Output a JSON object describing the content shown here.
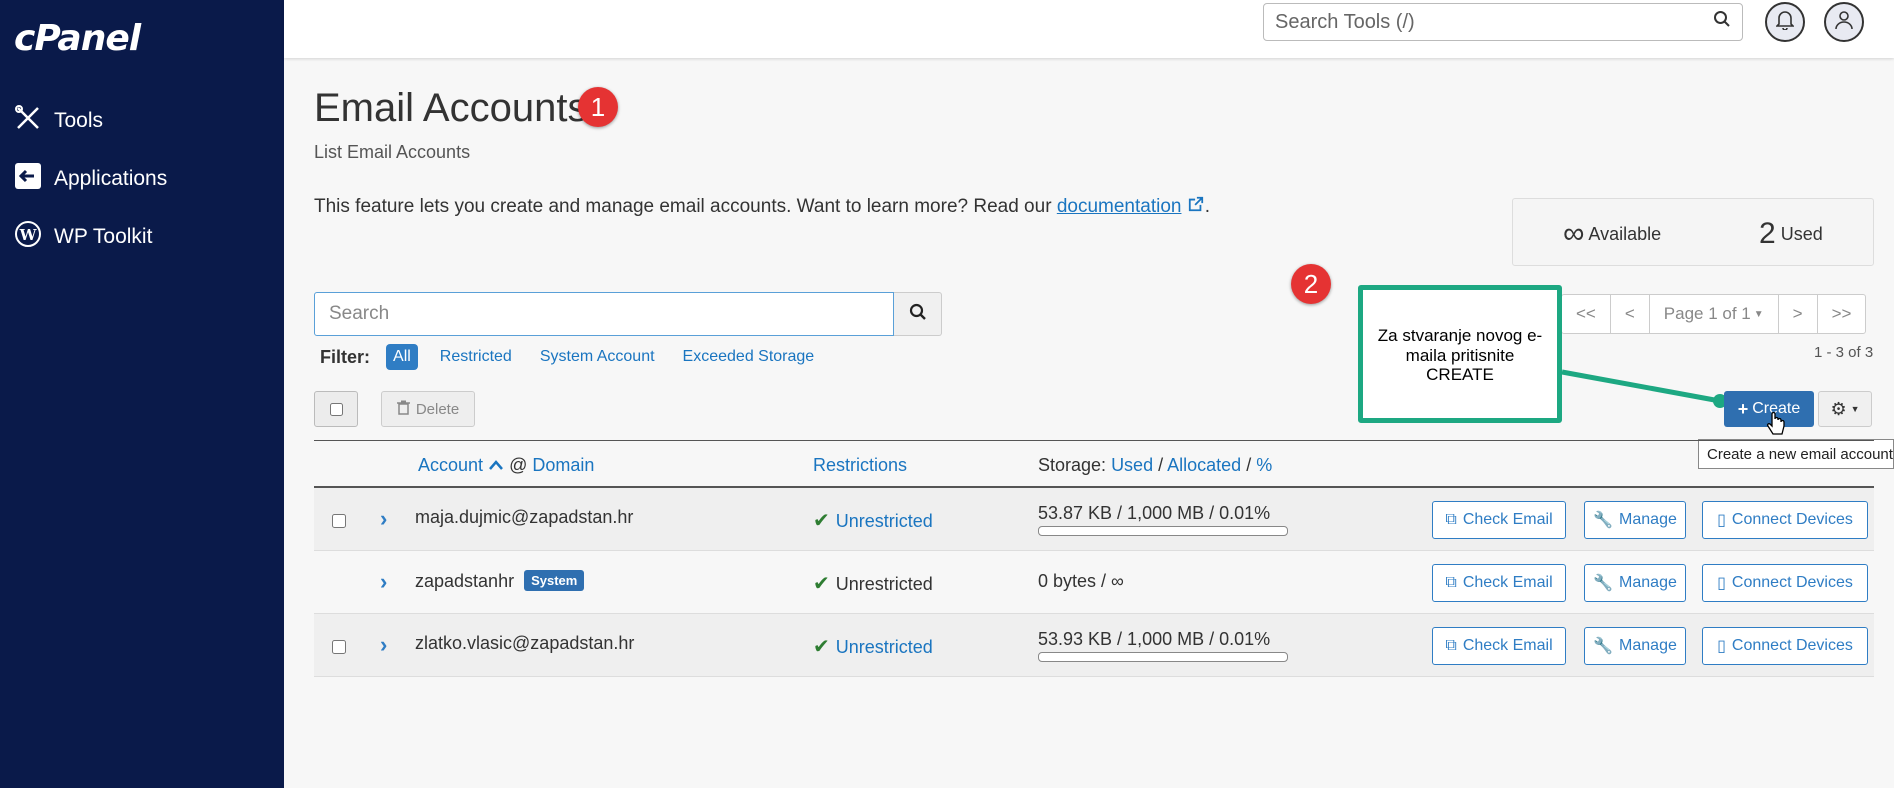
{
  "sidebar": {
    "logo": "cPanel",
    "items": [
      {
        "label": "Tools",
        "icon": "tools-icon"
      },
      {
        "label": "Applications",
        "icon": "applications-icon"
      },
      {
        "label": "WP Toolkit",
        "icon": "wordpress-icon"
      }
    ]
  },
  "header": {
    "search_placeholder": "Search Tools (/)"
  },
  "page": {
    "title": "Email Accounts",
    "subtitle": "List Email Accounts",
    "intro_text": "This feature lets you create and manage email accounts. Want to learn more? Read our ",
    "intro_link": "documentation",
    "intro_end": "."
  },
  "stats": {
    "available_value": "∞",
    "available_label": "Available",
    "used_value": "2",
    "used_label": "Used"
  },
  "search": {
    "placeholder": "Search"
  },
  "filter": {
    "label": "Filter:",
    "options": [
      "All",
      "Restricted",
      "System Account",
      "Exceeded Storage"
    ],
    "active": "All"
  },
  "toolbar": {
    "delete_label": "Delete",
    "create_label": "Create",
    "create_tooltip": "Create a new email account."
  },
  "pager": {
    "first": "<<",
    "prev": "<",
    "page_label": "Page 1 of 1",
    "next": ">",
    "last": ">>",
    "range": "1 - 3 of 3"
  },
  "annotations": {
    "badge1": "1",
    "badge2": "2",
    "callout": "Za stvaranje novog e-maila pritisnite CREATE"
  },
  "table": {
    "headers": {
      "account": "Account",
      "at": "@",
      "domain": "Domain",
      "restrictions": "Restrictions",
      "storage_prefix": "Storage:",
      "used": "Used",
      "slash1": "/",
      "allocated": "Allocated",
      "slash2": "/",
      "percent": "%"
    },
    "rows": [
      {
        "account": "maja.dujmic@zapadstan.hr",
        "restriction": "Unrestricted",
        "storage": "53.87 KB / 1,000 MB / 0.01%",
        "usage_fraction": 0.0001,
        "system": false
      },
      {
        "account": "zapadstanhr",
        "badge": "System",
        "restriction": "Unrestricted",
        "storage": "0 bytes / ∞",
        "system": true
      },
      {
        "account": "zlatko.vlasic@zapadstan.hr",
        "restriction": "Unrestricted",
        "storage": "53.93 KB / 1,000 MB / 0.01%",
        "usage_fraction": 0.0001,
        "system": false
      }
    ],
    "actions": {
      "check_email": "Check Email",
      "manage": "Manage",
      "connect_devices": "Connect Devices"
    }
  },
  "colors": {
    "sidebar_bg": "#0a1a4a",
    "accent": "#2f7dc4",
    "callout_border": "#1da882",
    "badge_red": "#e53333"
  }
}
